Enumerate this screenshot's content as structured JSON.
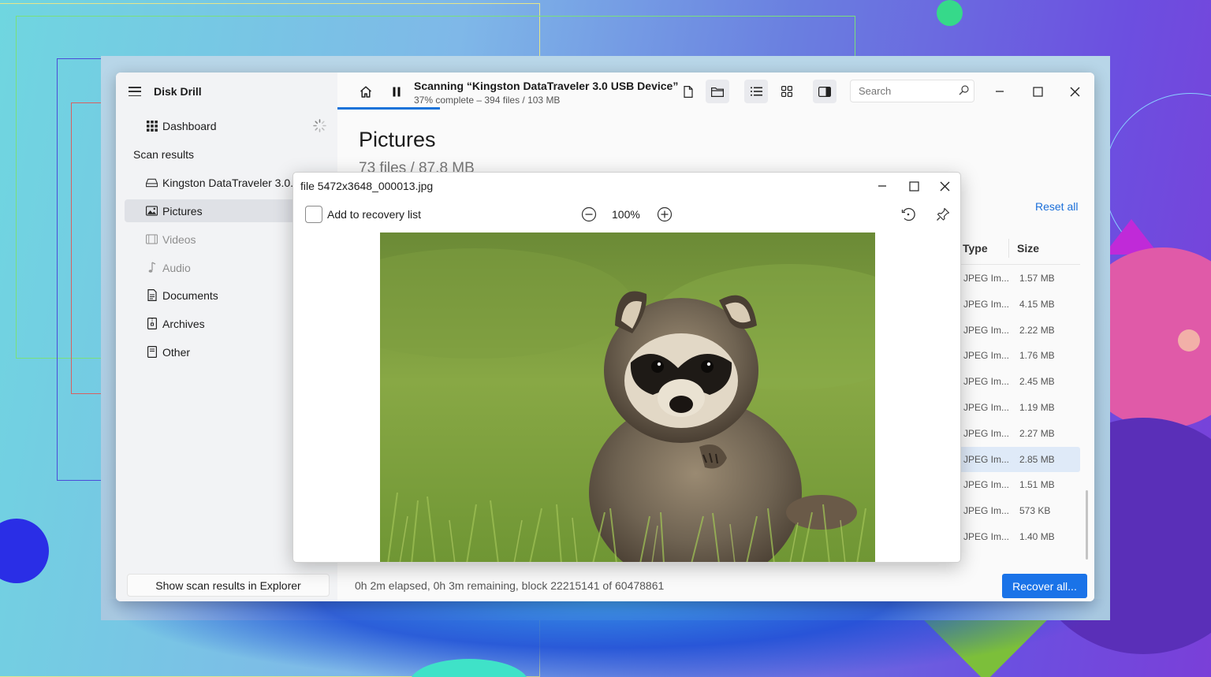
{
  "app": {
    "title": "Disk Drill"
  },
  "sidebar": {
    "dashboard_label": "Dashboard",
    "section_label": "Scan results",
    "items": [
      {
        "label": "Kingston DataTraveler 3.0...",
        "icon": "drive-icon",
        "state": "normal"
      },
      {
        "label": "Pictures",
        "icon": "picture-icon",
        "state": "active"
      },
      {
        "label": "Videos",
        "icon": "video-icon",
        "state": "disabled"
      },
      {
        "label": "Audio",
        "icon": "music-note-icon",
        "state": "disabled"
      },
      {
        "label": "Documents",
        "icon": "document-icon",
        "state": "normal"
      },
      {
        "label": "Archives",
        "icon": "archive-icon",
        "state": "normal"
      },
      {
        "label": "Other",
        "icon": "file-icon",
        "state": "normal"
      }
    ],
    "show_explorer_label": "Show scan results in Explorer"
  },
  "topbar": {
    "scan_title": "Scanning “Kingston DataTraveler 3.0 USB Device”",
    "scan_subtitle": "37% complete – 394 files / 103 MB",
    "progress": 0.37,
    "search_placeholder": "Search"
  },
  "main": {
    "title": "Pictures",
    "subtitle": "73 files / 87.8 MB",
    "reset_all_label": "Reset all",
    "columns": {
      "type": "Type",
      "size": "Size"
    },
    "rows": [
      {
        "type": "JPEG Im...",
        "size": "1.57 MB",
        "selected": false
      },
      {
        "type": "JPEG Im...",
        "size": "4.15 MB",
        "selected": false
      },
      {
        "type": "JPEG Im...",
        "size": "2.22 MB",
        "selected": false
      },
      {
        "type": "JPEG Im...",
        "size": "1.76 MB",
        "selected": false
      },
      {
        "type": "JPEG Im...",
        "size": "2.45 MB",
        "selected": false
      },
      {
        "type": "JPEG Im...",
        "size": "1.19 MB",
        "selected": false
      },
      {
        "type": "JPEG Im...",
        "size": "2.27 MB",
        "selected": false
      },
      {
        "type": "JPEG Im...",
        "size": "2.85 MB",
        "selected": true
      },
      {
        "type": "JPEG Im...",
        "size": "1.51 MB",
        "selected": false
      },
      {
        "type": "JPEG Im...",
        "size": "573 KB",
        "selected": false
      },
      {
        "type": "JPEG Im...",
        "size": "1.40 MB",
        "selected": false
      }
    ],
    "status": "0h 2m elapsed, 0h 3m remaining, block 22215141 of 60478861",
    "recover_all_label": "Recover all..."
  },
  "preview": {
    "title": "file 5472x3648_000013.jpg",
    "add_to_list_label": "Add to recovery list",
    "zoom": "100%"
  },
  "colors": {
    "accent": "#1a73e8",
    "link": "#1a6fd9",
    "selected_row": "#dfeaf8",
    "sidebar_active": "#dfe1e6"
  }
}
